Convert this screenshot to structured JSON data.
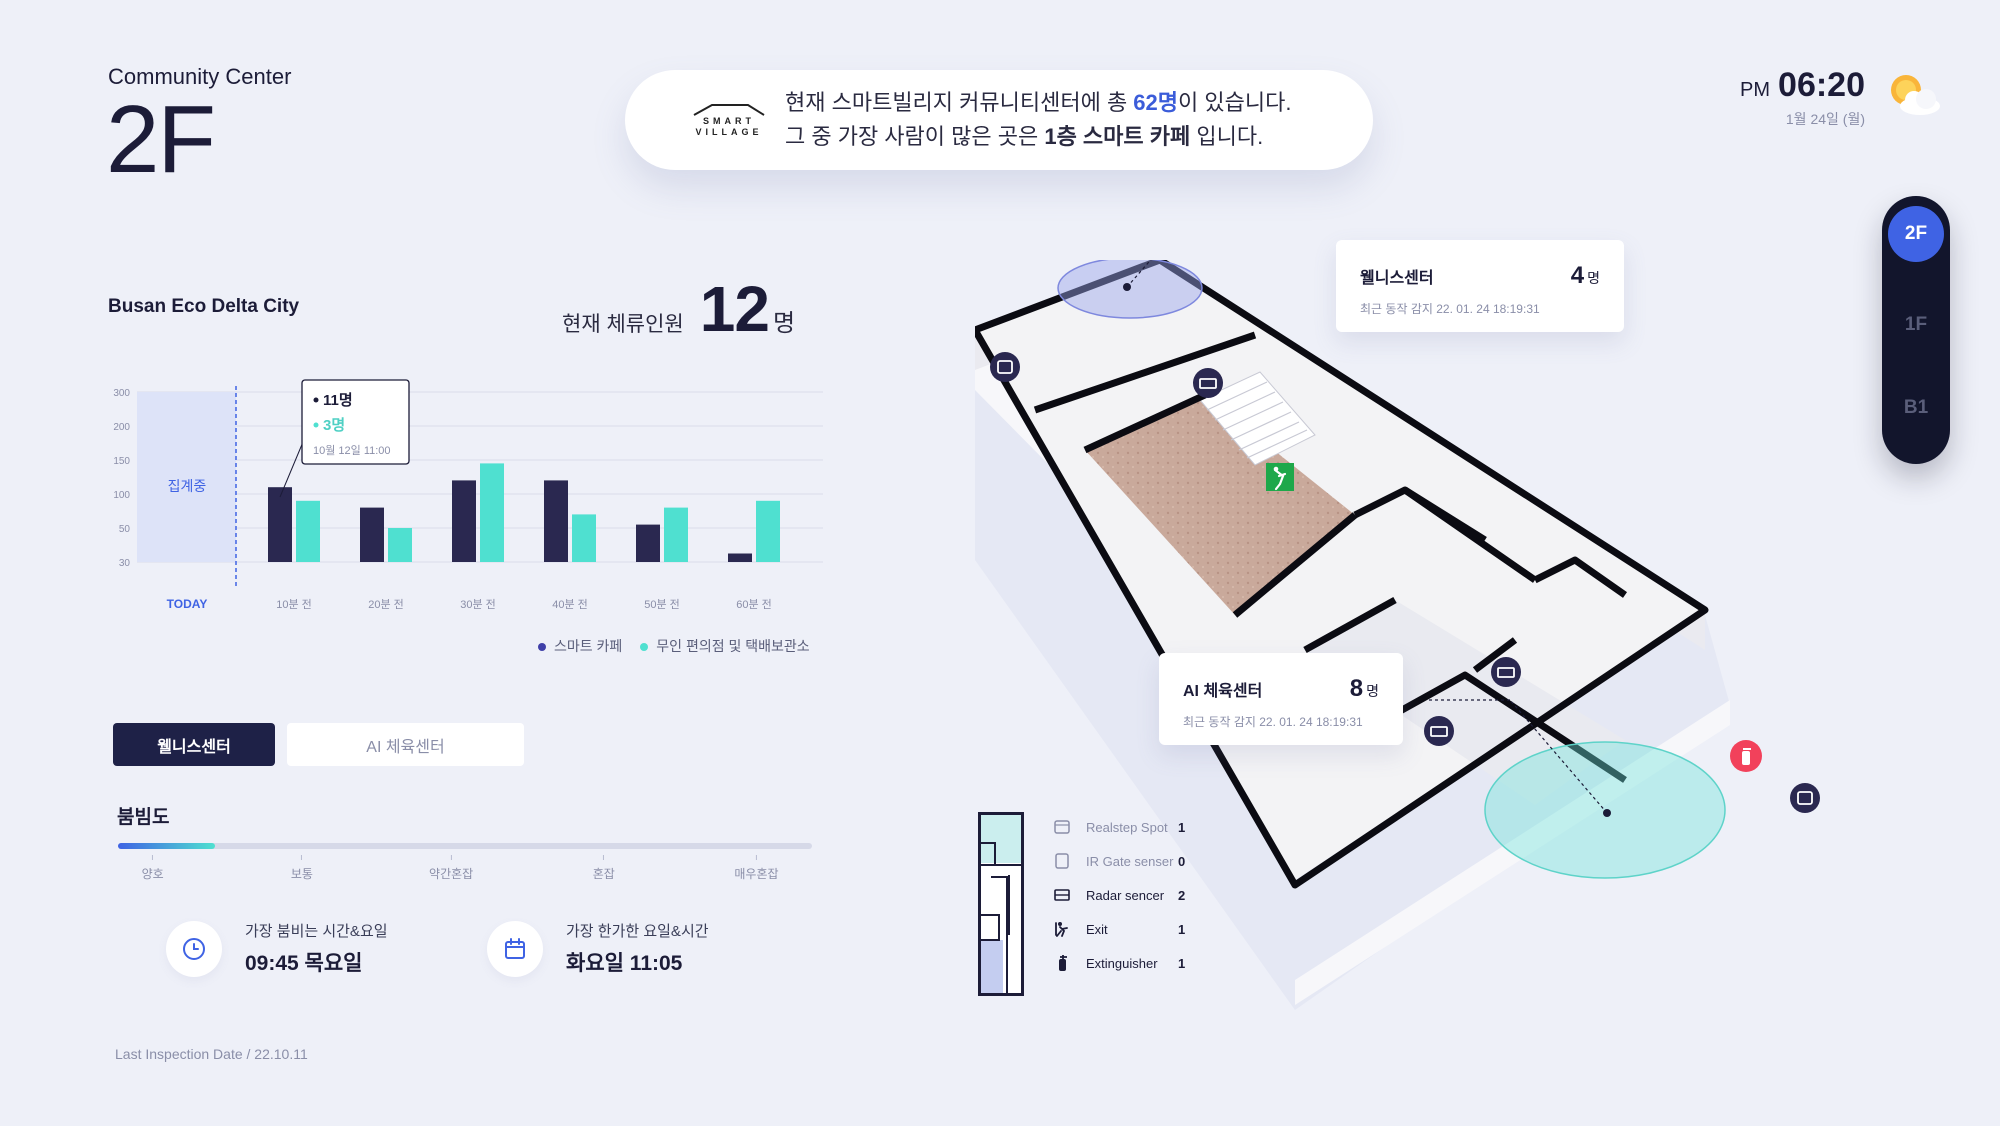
{
  "header": {
    "building": "Community Center",
    "floor": "2F"
  },
  "banner": {
    "logo_top": "SMART",
    "logo_bottom": "VILLAGE",
    "line1_prefix": "현재 스마트빌리지 커뮤니티센터에 총 ",
    "line1_count": "62명",
    "line1_suffix": "이 있습니다.",
    "line2_prefix": "그 중 가장 사람이 많은 곳은 ",
    "line2_place": "1층 스마트 카페",
    "line2_suffix": " 입니다."
  },
  "clock": {
    "ampm": "PM",
    "time": "06:20",
    "date": "1월 24일 (월)",
    "weather_icon": "partly-cloudy-icon"
  },
  "floor_nav": {
    "items": [
      "2F",
      "1F",
      "B1"
    ],
    "active": "2F"
  },
  "summary": {
    "city": "Busan Eco Delta City",
    "occupancy_label": "현재 체류인원",
    "occupancy_value": "12",
    "occupancy_unit": "명"
  },
  "chart_data": {
    "type": "bar",
    "categories": [
      "10분 전",
      "20분 전",
      "30분 전",
      "40분 전",
      "50분 전",
      "60분 전"
    ],
    "series": [
      {
        "name": "스마트 카페",
        "color": "#2a2850",
        "values": [
          110,
          80,
          120,
          120,
          55,
          35
        ]
      },
      {
        "name": "무인 편의점 및 택배보관소",
        "color": "#4fe0d0",
        "values": [
          90,
          50,
          145,
          70,
          80,
          90
        ]
      }
    ],
    "y_ticks": [
      "30",
      "50",
      "100",
      "150",
      "200",
      "300"
    ],
    "today_label": "TODAY",
    "today_status": "집계중",
    "tooltip": {
      "value1": "11명",
      "value2": "3명",
      "time": "10월 12일 11:00"
    }
  },
  "tabs": [
    {
      "label": "웰니스센터"
    },
    {
      "label": "AI 체육센터"
    }
  ],
  "congestion": {
    "title": "붐빔도",
    "level": 0.14,
    "ticks": [
      "양호",
      "보통",
      "약간혼잡",
      "혼잡",
      "매우혼잡"
    ]
  },
  "stats": {
    "busy_label": "가장 붐비는 시간&요일",
    "busy_value": "09:45 목요일",
    "quiet_label": "가장 한가한 요일&시간",
    "quiet_value": "화요일 11:05"
  },
  "footer": {
    "inspection": "Last Inspection Date / 22.10.11"
  },
  "rooms": [
    {
      "name": "웰니스센터",
      "count": "4",
      "unit": "명",
      "sub": "최근 동작 감지 22. 01. 24 18:19:31"
    },
    {
      "name": "AI 체육센터",
      "count": "8",
      "unit": "명",
      "sub": "최근 동작 감지 22. 01. 24 18:19:31"
    }
  ],
  "device_legend": [
    {
      "name": "Realstep Spot",
      "count": "1",
      "icon": "realstep-icon",
      "muted": true
    },
    {
      "name": "IR Gate senser",
      "count": "0",
      "icon": "ir-gate-icon",
      "muted": true
    },
    {
      "name": "Radar sencer",
      "count": "2",
      "icon": "radar-icon",
      "muted": false
    },
    {
      "name": "Exit",
      "count": "1",
      "icon": "exit-icon",
      "muted": false
    },
    {
      "name": "Extinguisher",
      "count": "1",
      "icon": "extinguisher-icon",
      "muted": false
    }
  ]
}
